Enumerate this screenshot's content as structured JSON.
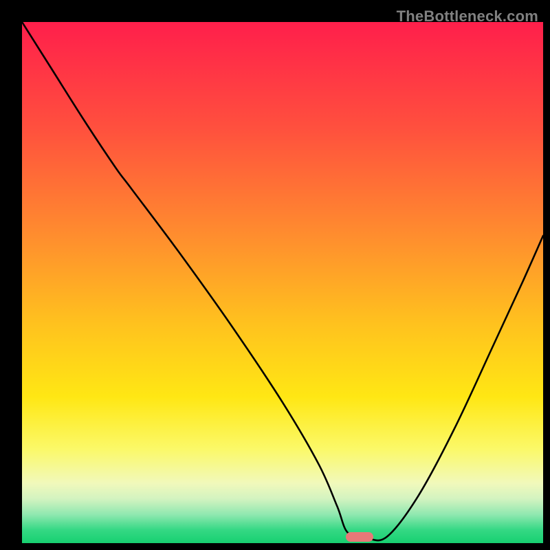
{
  "watermark": "TheBottleneck.com",
  "marker": {
    "color_hex": "#e87878",
    "x_frac": 0.648,
    "y_frac": 0.988
  },
  "gradient_stops": [
    {
      "offset": 0.0,
      "color": "#ff1f4b"
    },
    {
      "offset": 0.2,
      "color": "#ff4f3e"
    },
    {
      "offset": 0.4,
      "color": "#ff8a2f"
    },
    {
      "offset": 0.58,
      "color": "#ffc21e"
    },
    {
      "offset": 0.72,
      "color": "#ffe714"
    },
    {
      "offset": 0.82,
      "color": "#fbf969"
    },
    {
      "offset": 0.885,
      "color": "#f1f9bb"
    },
    {
      "offset": 0.915,
      "color": "#d3f3c0"
    },
    {
      "offset": 0.945,
      "color": "#90e8b0"
    },
    {
      "offset": 0.975,
      "color": "#34d884"
    },
    {
      "offset": 1.0,
      "color": "#17d070"
    }
  ],
  "chart_data": {
    "type": "line",
    "title": "",
    "xlabel": "",
    "ylabel": "",
    "xlim": [
      0,
      1
    ],
    "ylim": [
      0,
      1
    ],
    "series": [
      {
        "name": "bottleneck-curve",
        "x": [
          0.0,
          0.06,
          0.12,
          0.18,
          0.21,
          0.3,
          0.4,
          0.5,
          0.57,
          0.605,
          0.625,
          0.66,
          0.7,
          0.76,
          0.83,
          0.9,
          0.96,
          1.0
        ],
        "y": [
          1.0,
          0.905,
          0.81,
          0.72,
          0.68,
          0.56,
          0.42,
          0.27,
          0.15,
          0.07,
          0.02,
          0.01,
          0.012,
          0.09,
          0.22,
          0.37,
          0.5,
          0.59
        ]
      }
    ],
    "annotations": [
      {
        "type": "optimal-marker",
        "x": 0.648,
        "y": 0.012
      }
    ]
  }
}
